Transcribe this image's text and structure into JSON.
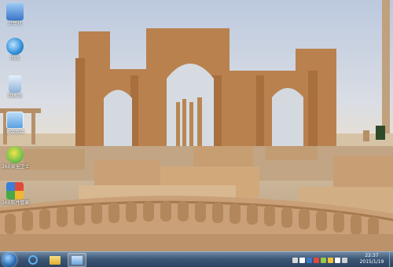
{
  "desktop": {
    "icons": [
      {
        "label": "计算机",
        "name": "computer-icon",
        "color": "#3b76c9"
      },
      {
        "label": "网络",
        "name": "network-icon",
        "color": "#2f8fd8"
      },
      {
        "label": "回收站",
        "name": "recycle-bin-icon",
        "color": "#8fb3d9"
      },
      {
        "label": "宽带连接",
        "name": "broadband-connection-icon",
        "color": "#5aa0e0"
      },
      {
        "label": "360安全卫士",
        "name": "360-security-icon",
        "color": "#6cc04a"
      },
      {
        "label": "360软件管家",
        "name": "360-software-manager-icon",
        "color": "#e04a3a"
      }
    ]
  },
  "taskbar": {
    "clock_time": "22:37",
    "clock_date": "2015/1/19",
    "pinned": [
      {
        "name": "ie-icon",
        "color": "#2d7fd6"
      },
      {
        "name": "file-explorer-icon",
        "color": "#e9c34e"
      },
      {
        "name": "network-window-icon",
        "color": "#7fb0e6"
      }
    ],
    "tray_colors": [
      "#d9d9d9",
      "#ffffff",
      "#3a78c8",
      "#e2483a",
      "#9ac948",
      "#f0c23a",
      "#ffffff",
      "#cfcfcf"
    ]
  }
}
